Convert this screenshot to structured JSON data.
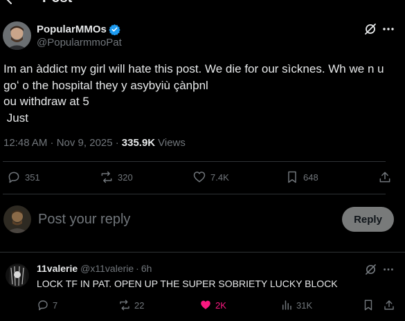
{
  "header": {
    "title": "Post"
  },
  "post": {
    "author_name": "PopularMMOs",
    "author_handle": "@PopularmmoPat",
    "text": "Im an àddict my girl will hate this post. We die for our sìcknes. Wh we n u\ngoʻ o the hospital they y asybyiù çànþnl\nou withdraw at 5\n Just",
    "time": "12:48 AM · Nov 9, 2025 · ",
    "views_count": "335.9K",
    "views_label": "Views",
    "stats": {
      "replies": "351",
      "reposts": "320",
      "likes": "7.4K",
      "bookmarks": "648"
    }
  },
  "reply_box": {
    "placeholder": "Post your reply",
    "button_label": "Reply"
  },
  "comment": {
    "name": "11valerie",
    "handle": "@x11valerie",
    "separator": "·",
    "time": "6h",
    "text": "LOCK TF IN PAT. OPEN UP THE SUPER SOBRIETY LUCKY BLOCK",
    "stats": {
      "replies": "7",
      "reposts": "22",
      "likes": "2K",
      "views": "31K"
    }
  },
  "colors": {
    "background": "#000000",
    "text": "#e7e9ea",
    "muted": "#71767b",
    "verified": "#1d9bf0",
    "like": "#f91880",
    "divider": "#2f3336"
  }
}
